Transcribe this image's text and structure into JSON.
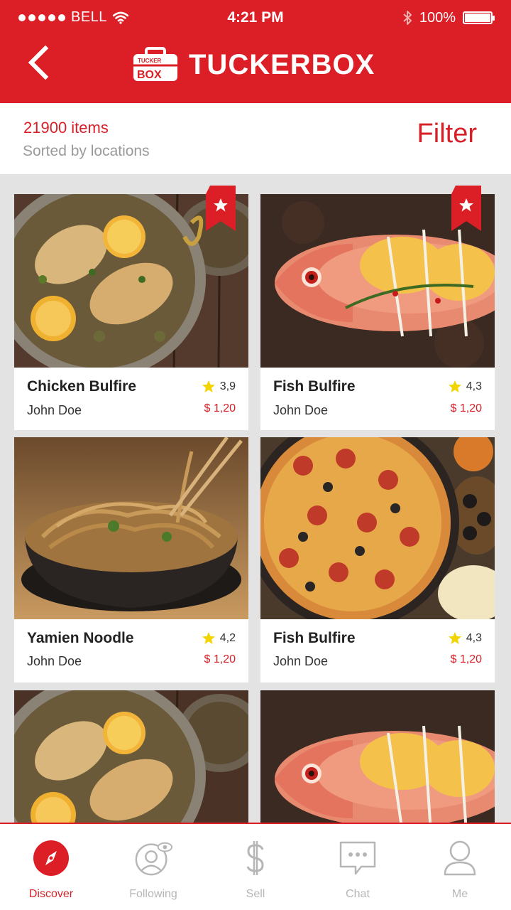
{
  "status": {
    "carrier": "BELL",
    "time": "4:21 PM",
    "battery": "100%"
  },
  "header": {
    "title": "TUCKERBOX",
    "logo_small": "TUCKER",
    "logo_big": "BOX"
  },
  "listing": {
    "count": "21900 items",
    "sort": "Sorted by locations",
    "filter_label": "Filter"
  },
  "items": [
    {
      "title": "Chicken Bulfire",
      "author": "John Doe",
      "rating": "3,9",
      "price": "$ 1,20",
      "favorite": true
    },
    {
      "title": "Fish Bulfire",
      "author": "John Doe",
      "rating": "4,3",
      "price": "$ 1,20",
      "favorite": true
    },
    {
      "title": "Yamien Noodle",
      "author": "John Doe",
      "rating": "4,2",
      "price": "$ 1,20",
      "favorite": false
    },
    {
      "title": "Fish Bulfire",
      "author": "John Doe",
      "rating": "4,3",
      "price": "$ 1,20",
      "favorite": false
    }
  ],
  "nav": [
    {
      "label": "Discover",
      "icon": "compass-icon",
      "active": true
    },
    {
      "label": "Following",
      "icon": "following-icon",
      "active": false
    },
    {
      "label": "Sell",
      "icon": "dollar-icon",
      "active": false
    },
    {
      "label": "Chat",
      "icon": "chat-icon",
      "active": false
    },
    {
      "label": "Me",
      "icon": "user-icon",
      "active": false
    }
  ],
  "colors": {
    "brand": "#dc1f26",
    "star": "#f2d400"
  }
}
